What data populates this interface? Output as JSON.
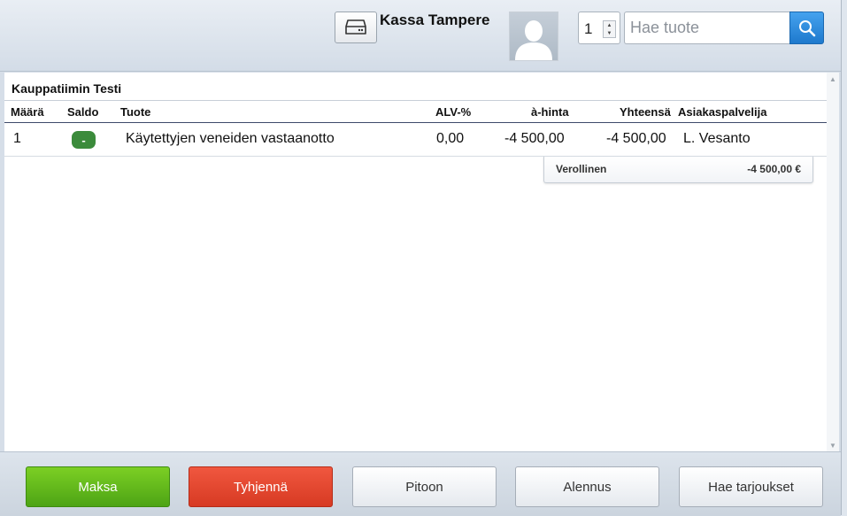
{
  "header": {
    "store_name": "Kassa Tampere",
    "quantity_value": "1",
    "search_placeholder": "Hae tuote"
  },
  "cart": {
    "customer_name": "Kauppatiimin Testi",
    "columns": {
      "maara": "Määrä",
      "saldo": "Saldo",
      "tuote": "Tuote",
      "alv": "ALV-%",
      "a_hinta": "à-hinta",
      "yhteensa": "Yhteensä",
      "asiakaspalvelija": "Asiakaspalvelija"
    },
    "rows": [
      {
        "maara": "1",
        "saldo": "-",
        "tuote": "Käytettyjen veneiden vastaanotto",
        "alv": "0,00",
        "a_hinta": "-4 500,00",
        "yhteensa": "-4 500,00",
        "asiakaspalvelija": "L. Vesanto"
      }
    ],
    "summary": {
      "label": "Verollinen",
      "value": "-4 500,00 €"
    }
  },
  "footer": {
    "pay_label": "Maksa",
    "clear_label": "Tyhjennä",
    "hold_label": "Pitoon",
    "discount_label": "Alennus",
    "offers_label": "Hae tarjoukset"
  },
  "colors": {
    "pay_green": "#5fb81a",
    "clear_red": "#e5482f",
    "search_blue": "#2d8ee0",
    "saldo_green": "#3b8b3b"
  },
  "icons": {
    "drawer": "cash-drawer-icon",
    "avatar": "user-avatar-icon",
    "search": "magnifier-icon"
  }
}
